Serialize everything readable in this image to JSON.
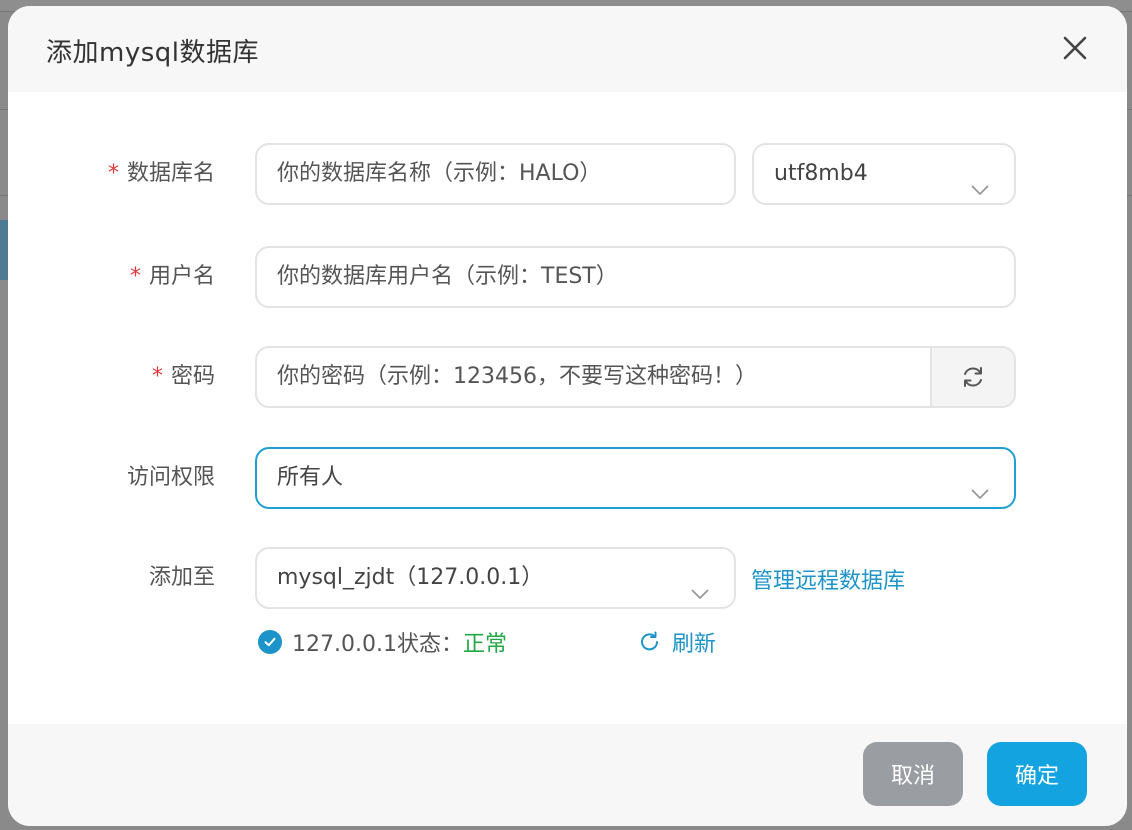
{
  "dialog": {
    "title": "添加mysql数据库"
  },
  "form": {
    "db_name": {
      "label": "数据库名",
      "placeholder": "你的数据库名称（示例：HALO）",
      "charset": "utf8mb4"
    },
    "username": {
      "label": "用户名",
      "placeholder": "你的数据库用户名（示例：TEST）"
    },
    "password": {
      "label": "密码",
      "placeholder": "你的密码（示例：123456，不要写这种密码！）"
    },
    "access": {
      "label": "访问权限",
      "value": "所有人"
    },
    "add_to": {
      "label": "添加至",
      "value": "mysql_zjdt（127.0.0.1）",
      "manage_link": "管理远程数据库"
    },
    "status": {
      "prefix": "127.0.0.1状态：",
      "value": "正常",
      "refresh": "刷新"
    },
    "required_mark": "*"
  },
  "footer": {
    "cancel": "取消",
    "confirm": "确定"
  },
  "colors": {
    "accent": "#12a3e0",
    "link": "#1d94c9",
    "ok": "#23a846",
    "required": "#e4393c",
    "cancel": "#9a9da2"
  }
}
